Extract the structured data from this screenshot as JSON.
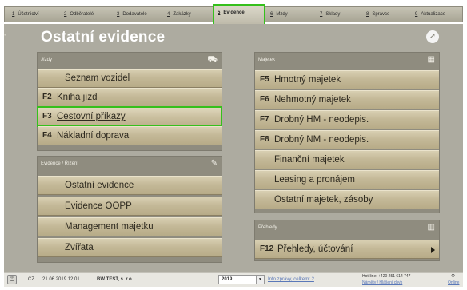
{
  "tabs": [
    {
      "num": "1",
      "label": "Účetnictví"
    },
    {
      "num": "2",
      "label": "Odběratelé"
    },
    {
      "num": "3",
      "label": "Dodavatelé"
    },
    {
      "num": "4",
      "label": "Zakázky"
    },
    {
      "num": "5",
      "label": "Evidence"
    },
    {
      "num": "6",
      "label": "Mzdy"
    },
    {
      "num": "7",
      "label": "Sklady"
    },
    {
      "num": "8",
      "label": "Správce"
    },
    {
      "num": "9",
      "label": "Aktualizace"
    }
  ],
  "page": {
    "title": "Ostatní evidence"
  },
  "jizdy": {
    "header": "Jízdy",
    "items": [
      {
        "key": "",
        "label": "Seznam vozidel"
      },
      {
        "key": "F2",
        "label": "Kniha jízd"
      },
      {
        "key": "F3",
        "label": "Cestovní příkazy"
      },
      {
        "key": "F4",
        "label": "Nákladní doprava"
      }
    ]
  },
  "evidence": {
    "header": "Evidence / Řízení",
    "items": [
      {
        "key": "",
        "label": "Ostatní evidence"
      },
      {
        "key": "",
        "label": "Evidence OOPP"
      },
      {
        "key": "",
        "label": "Management majetku"
      },
      {
        "key": "",
        "label": "Zvířata"
      }
    ]
  },
  "majetek": {
    "header": "Majetek",
    "items": [
      {
        "key": "F5",
        "label": "Hmotný majetek"
      },
      {
        "key": "F6",
        "label": "Nehmotný majetek"
      },
      {
        "key": "F7",
        "label": "Drobný HM - neodepis."
      },
      {
        "key": "F8",
        "label": "Drobný NM - neodepis."
      },
      {
        "key": "",
        "label": "Finanční majetek"
      },
      {
        "key": "",
        "label": "Leasing a pronájem"
      },
      {
        "key": "",
        "label": "Ostatní majetek, zásoby"
      }
    ]
  },
  "prehledy": {
    "header": "Přehledy",
    "items": [
      {
        "key": "F12",
        "label": "Přehledy, účtování"
      }
    ]
  },
  "status": {
    "lang": "CZ",
    "datetime": "21.06.2019 12:01",
    "company": "BW TEST, s. r.o.",
    "year": "2019",
    "info_link": "Info zprávy, celkem: 2",
    "hotline": "Hot-line: +420 251 614 747",
    "feedback_link": "Náměty / Hlášení chyb",
    "online": "Online"
  },
  "icons": {
    "jizdy": "truck-icon",
    "evidence": "pencil-icon",
    "majetek": "building-icon",
    "prehledy": "bar-chart-icon",
    "corner": "logo-icon",
    "power": "power-icon"
  },
  "colors": {
    "panel_bg": "#adaba0",
    "item_gold": "#c4b998",
    "highlight": "#35c01c"
  }
}
